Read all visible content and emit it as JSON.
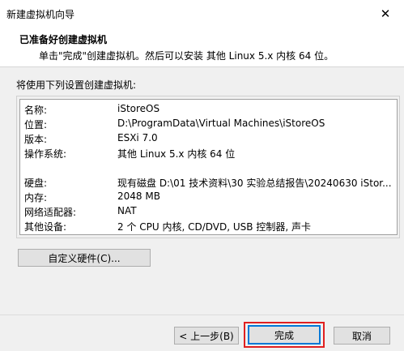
{
  "window": {
    "title": "新建虚拟机向导",
    "close_symbol": "✕"
  },
  "header": {
    "title": "已准备好创建虚拟机",
    "subtitle": "单击\"完成\"创建虚拟机。然后可以安装 其他 Linux 5.x 内核 64 位。"
  },
  "body": {
    "label": "将使用下列设置创建虚拟机:"
  },
  "summary": {
    "rows": [
      {
        "key": "名称:",
        "value": "iStoreOS"
      },
      {
        "key": "位置:",
        "value": "D:\\ProgramData\\Virtual Machines\\iStoreOS"
      },
      {
        "key": "版本:",
        "value": "ESXi 7.0"
      },
      {
        "key": "操作系统:",
        "value": "其他 Linux 5.x 内核 64 位"
      },
      {
        "key": "硬盘:",
        "value": "现有磁盘 D:\\01 技术资料\\30 实验总结报告\\20240630 iStor..."
      },
      {
        "key": "内存:",
        "value": "2048 MB"
      },
      {
        "key": "网络适配器:",
        "value": "NAT"
      },
      {
        "key": "其他设备:",
        "value": "2 个 CPU 内核, CD/DVD, USB 控制器, 声卡"
      }
    ]
  },
  "buttons": {
    "customize": "自定义硬件(C)...",
    "back": "< 上一步(B)",
    "finish": "完成",
    "cancel": "取消"
  },
  "colors": {
    "highlight": "#e02020",
    "default_button": "#0078d7"
  }
}
